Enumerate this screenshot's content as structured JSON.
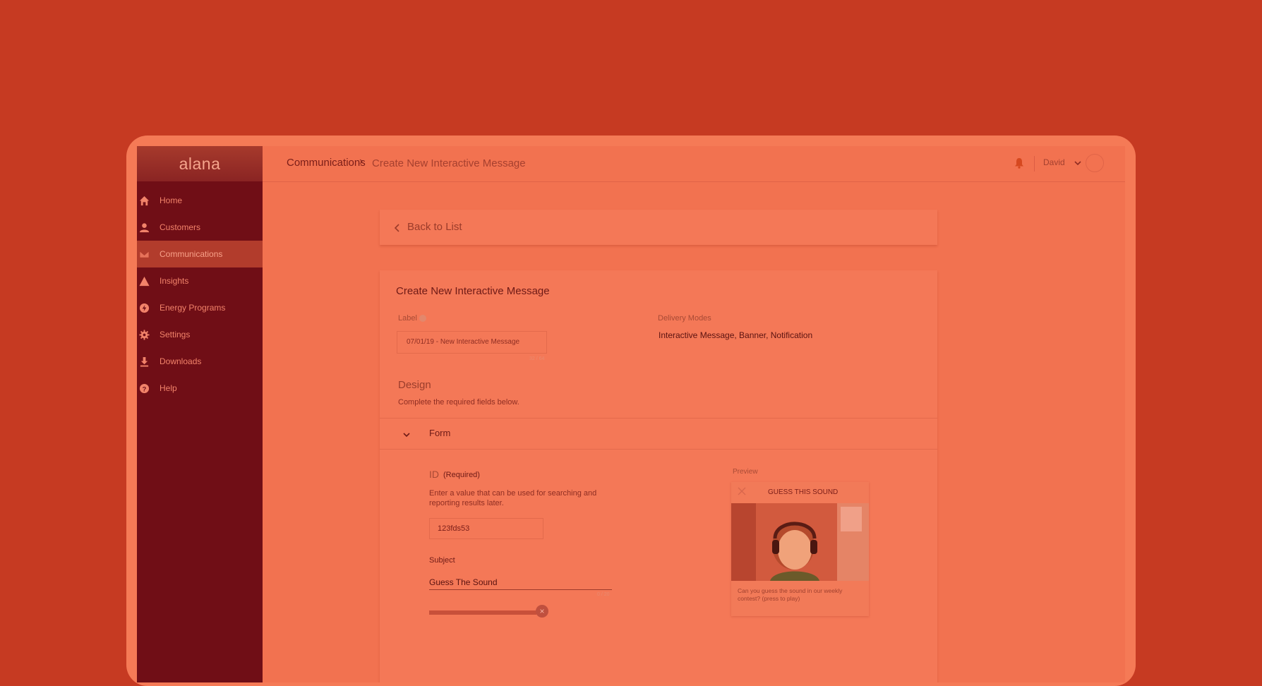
{
  "app": {
    "logo": "alana"
  },
  "sidebar": {
    "items": [
      {
        "label": "Home",
        "icon": "home-icon"
      },
      {
        "label": "Customers",
        "icon": "user-icon"
      },
      {
        "label": "Communications",
        "icon": "mail-icon",
        "active": true
      },
      {
        "label": "Insights",
        "icon": "warning-icon"
      },
      {
        "label": "Energy Programs",
        "icon": "bolt-icon"
      },
      {
        "label": "Settings",
        "icon": "gear-icon"
      },
      {
        "label": "Downloads",
        "icon": "download-icon"
      },
      {
        "label": "Help",
        "icon": "help-icon"
      }
    ]
  },
  "header": {
    "breadcrumb_root": "Communications",
    "breadcrumb_current": "Create New Interactive Message",
    "user_name": "David"
  },
  "back": {
    "label": "Back to List"
  },
  "form": {
    "title": "Create New Interactive Message",
    "label_field": {
      "label": "Label",
      "value": "07/01/19  -  New Interactive Message",
      "counter": "32 / 64"
    },
    "delivery_modes": {
      "label": "Delivery Modes",
      "value": "Interactive Message, Banner, Notification"
    },
    "design": {
      "title": "Design",
      "subtitle": "Complete the required fields below."
    },
    "section": {
      "title": "Form"
    },
    "id_field": {
      "label": "ID",
      "required": "(Required)",
      "help": "Enter a value that can be used for searching and reporting results later.",
      "value": "123fds53"
    },
    "subject_field": {
      "label": "Subject",
      "value": "Guess The Sound",
      "counter": "0 / 20"
    }
  },
  "preview": {
    "label": "Preview",
    "title": "GUESS THIS SOUND",
    "text": "Can you guess the sound in our weekly contest? (press to play)"
  },
  "colors": {
    "background": "#c63a22",
    "sidebar": "#700e16",
    "accent": "#d6481f"
  }
}
